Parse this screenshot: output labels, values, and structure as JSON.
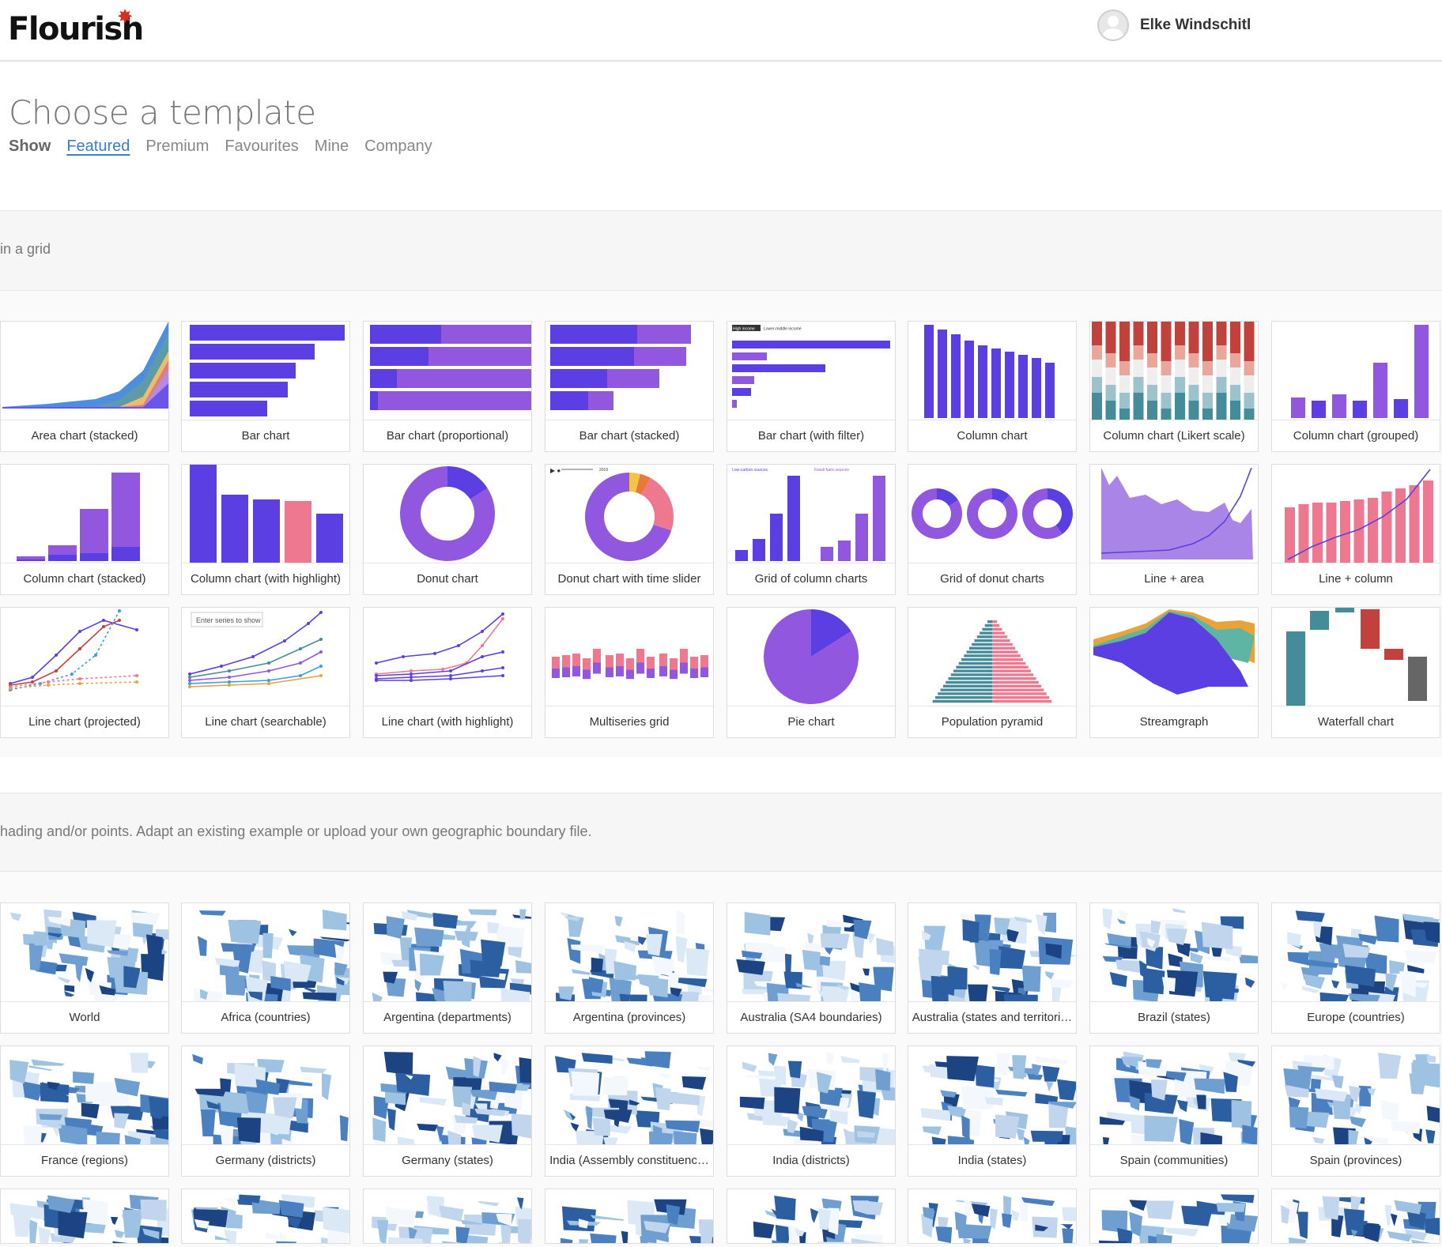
{
  "brand": {
    "name": "Flourish",
    "star": "✸"
  },
  "user": {
    "name": "Elke Windschitl"
  },
  "page_title": "Choose a template",
  "filters": {
    "show_label": "Show",
    "items": [
      "Featured",
      "Premium",
      "Favourites",
      "Mine",
      "Company"
    ],
    "active": "Featured"
  },
  "sections": {
    "charts_desc": "in a grid",
    "maps_desc": "hading and/or points. Adapt an existing example or upload your own geographic boundary file."
  },
  "chart_templates": [
    {
      "label": "Area chart (stacked)",
      "icon": "area-stacked"
    },
    {
      "label": "Bar chart",
      "icon": "bar"
    },
    {
      "label": "Bar chart (proportional)",
      "icon": "bar-proportional"
    },
    {
      "label": "Bar chart (stacked)",
      "icon": "bar-stacked"
    },
    {
      "label": "Bar chart (with filter)",
      "icon": "bar-filter"
    },
    {
      "label": "Column chart",
      "icon": "column"
    },
    {
      "label": "Column chart (Likert scale)",
      "icon": "column-likert"
    },
    {
      "label": "Column chart (grouped)",
      "icon": "column-grouped"
    },
    {
      "label": "Column chart (stacked)",
      "icon": "column-stacked"
    },
    {
      "label": "Column chart (with highlight)",
      "icon": "column-highlight"
    },
    {
      "label": "Donut chart",
      "icon": "donut"
    },
    {
      "label": "Donut chart with time slider",
      "icon": "donut-slider"
    },
    {
      "label": "Grid of column charts",
      "icon": "grid-columns"
    },
    {
      "label": "Grid of donut charts",
      "icon": "grid-donuts"
    },
    {
      "label": "Line + area",
      "icon": "line-area"
    },
    {
      "label": "Line + column",
      "icon": "line-column"
    },
    {
      "label": "Line chart (projected)",
      "icon": "line-projected"
    },
    {
      "label": "Line chart (searchable)",
      "icon": "line-searchable"
    },
    {
      "label": "Line chart (with highlight)",
      "icon": "line-highlight"
    },
    {
      "label": "Multiseries grid",
      "icon": "multiseries"
    },
    {
      "label": "Pie chart",
      "icon": "pie"
    },
    {
      "label": "Population pyramid",
      "icon": "pyramid"
    },
    {
      "label": "Streamgraph",
      "icon": "stream"
    },
    {
      "label": "Waterfall chart",
      "icon": "waterfall"
    }
  ],
  "thumb_text": {
    "searchable_placeholder": "Enter series to show",
    "filter_tag_1": "High income",
    "filter_tag_2": "Lower-middle income",
    "grid_col_1": "Low-carbon sources",
    "grid_col_2": "Fossil fuels sources",
    "slider_year": "2019"
  },
  "map_templates": [
    {
      "label": "World"
    },
    {
      "label": "Africa (countries)"
    },
    {
      "label": "Argentina (departments)"
    },
    {
      "label": "Argentina (provinces)"
    },
    {
      "label": "Australia (SA4 boundaries)"
    },
    {
      "label": "Australia (states and territori…"
    },
    {
      "label": "Brazil (states)"
    },
    {
      "label": "Europe (countries)"
    },
    {
      "label": "France (regions)"
    },
    {
      "label": "Germany (districts)"
    },
    {
      "label": "Germany (states)"
    },
    {
      "label": "India (Assembly constituenc…"
    },
    {
      "label": "India (districts)"
    },
    {
      "label": "India (states)"
    },
    {
      "label": "Spain (communities)"
    },
    {
      "label": "Spain (provinces)"
    },
    {
      "label": ""
    },
    {
      "label": ""
    },
    {
      "label": ""
    },
    {
      "label": ""
    },
    {
      "label": ""
    },
    {
      "label": ""
    },
    {
      "label": ""
    },
    {
      "label": ""
    }
  ],
  "colors": {
    "purple": "#5b3fe3",
    "lilac": "#9157de",
    "pink": "#ef7891",
    "teal": "#448c9a",
    "red": "#c1413c",
    "link": "#3b7fc4"
  }
}
